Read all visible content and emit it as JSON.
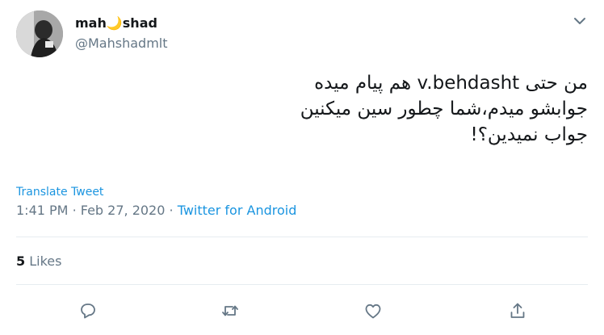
{
  "user": {
    "display_name": "mah🌙shad",
    "handle": "@Mahshadmlt"
  },
  "tweet": {
    "lines": [
      "من حتی v.behdasht هم پیام میده",
      "جوابشو میدم،شما چطور سین میکنین",
      "جواب نمیدین؟!"
    ],
    "translate_label": "Translate Tweet",
    "time": "1:41 PM",
    "date": "Feb 27, 2020",
    "separator": "·",
    "source": "Twitter for Android"
  },
  "stats": {
    "likes_count": "5",
    "likes_label": "Likes"
  },
  "actions": [
    "reply-icon",
    "retweet-icon",
    "like-icon",
    "share-icon"
  ],
  "colors": {
    "link": "#1b95e0",
    "secondary_text": "#657786",
    "primary_text": "#14171a",
    "divider": "#e6ecf0"
  }
}
